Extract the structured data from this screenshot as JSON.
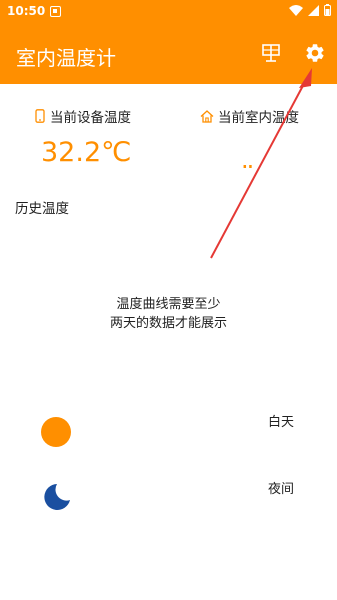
{
  "status_bar": {
    "time": "10:50"
  },
  "app_bar": {
    "title": "室内温度计"
  },
  "device_card": {
    "label": "当前设备温度",
    "value": "32.2℃"
  },
  "room_card": {
    "label": "当前室内温度",
    "value": ".."
  },
  "history": {
    "title": "历史温度",
    "empty_line1": "温度曲线需要至少",
    "empty_line2": "两天的数据才能展示"
  },
  "legend": {
    "day_label": "白天",
    "night_label": "夜间"
  },
  "colors": {
    "accent": "#FF8F00",
    "moon": "#1A4FA0",
    "annotation": "#E53935"
  },
  "icons": [
    "phone-icon",
    "home-icon",
    "widget-icon",
    "settings-icon",
    "sun-icon",
    "moon-icon"
  ]
}
